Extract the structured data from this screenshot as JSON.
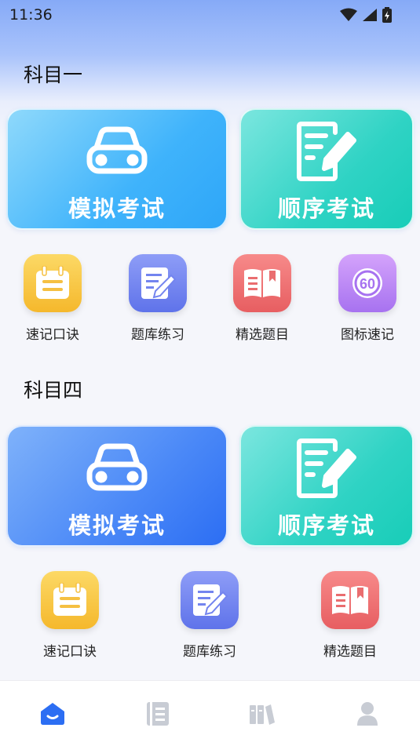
{
  "status_bar": {
    "time": "11:36",
    "icons": [
      "wifi-icon",
      "signal-icon",
      "battery-charging-icon"
    ]
  },
  "subject1": {
    "title": "科目一",
    "cards": [
      {
        "label": "模拟考试",
        "icon": "car-icon",
        "color": "#3fb3fb"
      },
      {
        "label": "顺序考试",
        "icon": "document-edit-icon",
        "color": "#2fd3c4"
      }
    ],
    "tiles": [
      {
        "label": "速记口诀",
        "icon": "notepad-icon",
        "color": "#f5b82c"
      },
      {
        "label": "题库练习",
        "icon": "writing-icon",
        "color": "#5f73ea"
      },
      {
        "label": "精选题目",
        "icon": "book-icon",
        "color": "#e75e61"
      },
      {
        "label": "图标速记",
        "icon": "speed-limit-60-icon",
        "color": "#a772f0",
        "badge_text": "60"
      }
    ]
  },
  "subject4": {
    "title": "科目四",
    "cards": [
      {
        "label": "模拟考试",
        "icon": "car-icon",
        "color": "#4a88f7"
      },
      {
        "label": "顺序考试",
        "icon": "document-edit-icon",
        "color": "#2fd3c4"
      }
    ],
    "tiles": [
      {
        "label": "速记口诀",
        "icon": "notepad-icon",
        "color": "#f5b82c"
      },
      {
        "label": "题库练习",
        "icon": "writing-icon",
        "color": "#5f73ea"
      },
      {
        "label": "精选题目",
        "icon": "book-icon",
        "color": "#e75e61"
      }
    ]
  },
  "bottom_nav": {
    "items": [
      {
        "icon": "home-icon",
        "active": true,
        "color": "#2c6ef3"
      },
      {
        "icon": "list-icon",
        "active": false,
        "color": "#c8ccd4"
      },
      {
        "icon": "library-icon",
        "active": false,
        "color": "#c8ccd4"
      },
      {
        "icon": "profile-icon",
        "active": false,
        "color": "#c8ccd4"
      }
    ]
  }
}
